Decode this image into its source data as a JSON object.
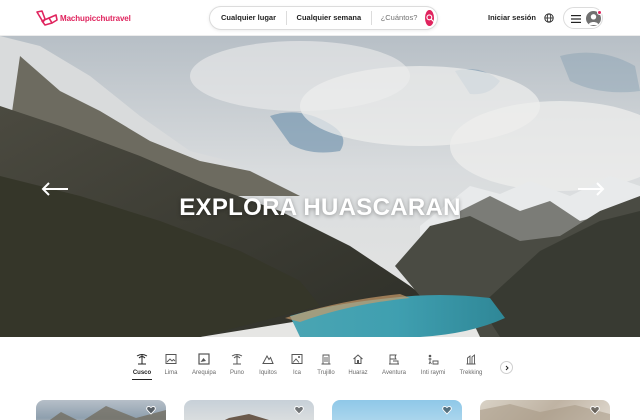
{
  "brand": {
    "name": "Machupicchutravel",
    "color": "#e0245e"
  },
  "search": {
    "place_label": "Cualquier lugar",
    "week_label": "Cualquier semana",
    "guests_placeholder": "¿Cuántos?",
    "button_icon": "search-icon"
  },
  "header": {
    "login_label": "Iniciar sesión",
    "globe_icon": "globe-icon",
    "menu_icon": "hamburger-icon",
    "avatar_icon": "user-avatar-icon"
  },
  "hero": {
    "title": "EXPLORA HUASCARAN",
    "prev_icon": "arrow-left-icon",
    "next_icon": "arrow-right-icon"
  },
  "categories": [
    {
      "label": "Cusco",
      "icon": "palm-tree-icon",
      "active": true
    },
    {
      "label": "Lima",
      "icon": "picture-icon",
      "active": false
    },
    {
      "label": "Arequipa",
      "icon": "image-frame-icon",
      "active": false
    },
    {
      "label": "Puno",
      "icon": "palm-tree-icon",
      "active": false
    },
    {
      "label": "Iquitos",
      "icon": "mountain-icon",
      "active": false
    },
    {
      "label": "Ica",
      "icon": "landscape-icon",
      "active": false
    },
    {
      "label": "Trujillo",
      "icon": "building-icon",
      "active": false
    },
    {
      "label": "Huaraz",
      "icon": "house-icon",
      "active": false
    },
    {
      "label": "Aventura",
      "icon": "flag-building-icon",
      "active": false
    },
    {
      "label": "Inti raymi",
      "icon": "person-sun-icon",
      "active": false
    },
    {
      "label": "Trekking",
      "icon": "bar-chart-icon",
      "active": false
    }
  ],
  "categories_next_icon": "chevron-right-icon",
  "cards": [
    {
      "heart_icon": "heart-icon"
    },
    {
      "heart_icon": "heart-icon"
    },
    {
      "heart_icon": "heart-icon"
    },
    {
      "heart_icon": "heart-icon"
    }
  ]
}
